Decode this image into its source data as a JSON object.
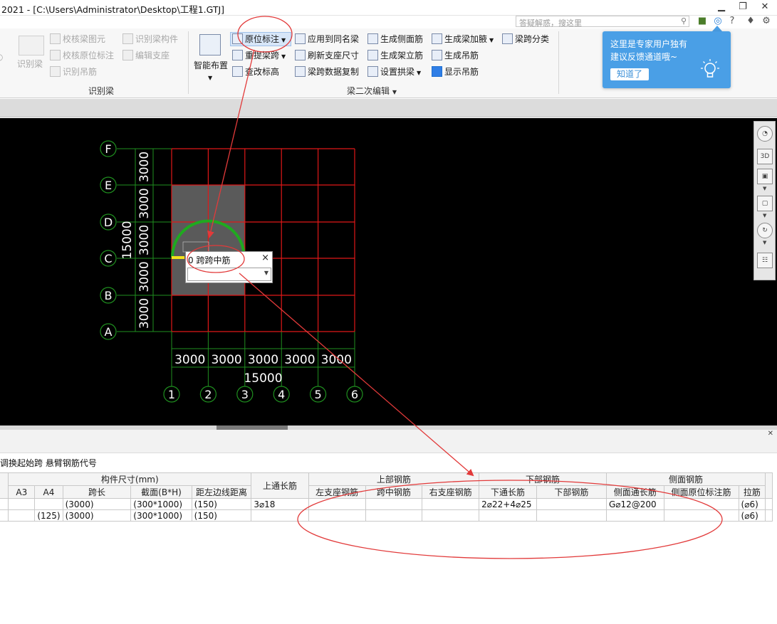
{
  "window": {
    "title": "2021 - [C:\\Users\\Administrator\\Desktop\\工程1.GTJ]",
    "search_placeholder": "答疑解惑，搜这里",
    "help_label": "?"
  },
  "ribbon": {
    "identify_group": {
      "label": "识别梁",
      "big_button": "识别梁",
      "items": [
        "校核梁图元",
        "校核原位标注",
        "识别吊筋",
        "识别梁构件",
        "编辑支座"
      ]
    },
    "smart_layout": "智能布置",
    "beam_edit_group": {
      "label": "梁二次编辑",
      "items": [
        "原位标注",
        "重提梁跨",
        "查改标高",
        "应用到同名梁",
        "刷新支座尺寸",
        "梁跨数据复制",
        "生成侧面筋",
        "生成架立筋",
        "设置拱梁",
        "生成梁加腋",
        "生成吊筋",
        "显示吊筋",
        "梁跨分类"
      ]
    }
  },
  "tip": {
    "line1": "这里是专家用户独有",
    "line2": "建议反馈通道哦~",
    "button": "知道了"
  },
  "drawing": {
    "row_axes": [
      "F",
      "E",
      "D",
      "C",
      "B",
      "A"
    ],
    "col_axes": [
      "1",
      "2",
      "3",
      "4",
      "5",
      "6"
    ],
    "row_dims": [
      "3000",
      "3000",
      "3000",
      "3000",
      "3000"
    ],
    "col_dims": [
      "3000",
      "3000",
      "3000",
      "3000",
      "3000"
    ],
    "total_v": "15000",
    "total_h": "15000"
  },
  "span_popup": {
    "text": "0 跨跨中筋",
    "close": "×"
  },
  "panel": {
    "toolbar": "调换起始跨   悬臂钢筋代号",
    "headers": {
      "size_group": "构件尺寸(mm)",
      "top_through": "上通长筋",
      "top_group": "上部钢筋",
      "bottom_group": "下部钢筋",
      "side_group": "侧面钢筋",
      "cols": [
        "A3",
        "A4",
        "跨长",
        "截面(B*H)",
        "距左边线距离",
        "左支座钢筋",
        "跨中钢筋",
        "右支座钢筋",
        "下通长筋",
        "下部钢筋",
        "侧面通长筋",
        "侧面原位标注筋",
        "拉筋"
      ]
    },
    "rows": [
      {
        "a4": "",
        "span": "(3000)",
        "section": "(300*1000)",
        "dist": "(150)",
        "top_through": "3⌀18",
        "bottom_through": "2⌀22+4⌀25",
        "side_through": "G⌀12@200",
        "tie": "(⌀6)"
      },
      {
        "a4": "(125)",
        "span": "(3000)",
        "section": "(300*1000)",
        "dist": "(150)",
        "top_through": "",
        "bottom_through": "",
        "side_through": "",
        "tie": "(⌀6)"
      }
    ]
  },
  "colors": {
    "grid_red": "#e01818",
    "axis_green": "#1f8f1f",
    "arc_green": "#1faa1f",
    "annotation_red": "#e23a3a",
    "tip_blue": "#4a9fe6"
  }
}
